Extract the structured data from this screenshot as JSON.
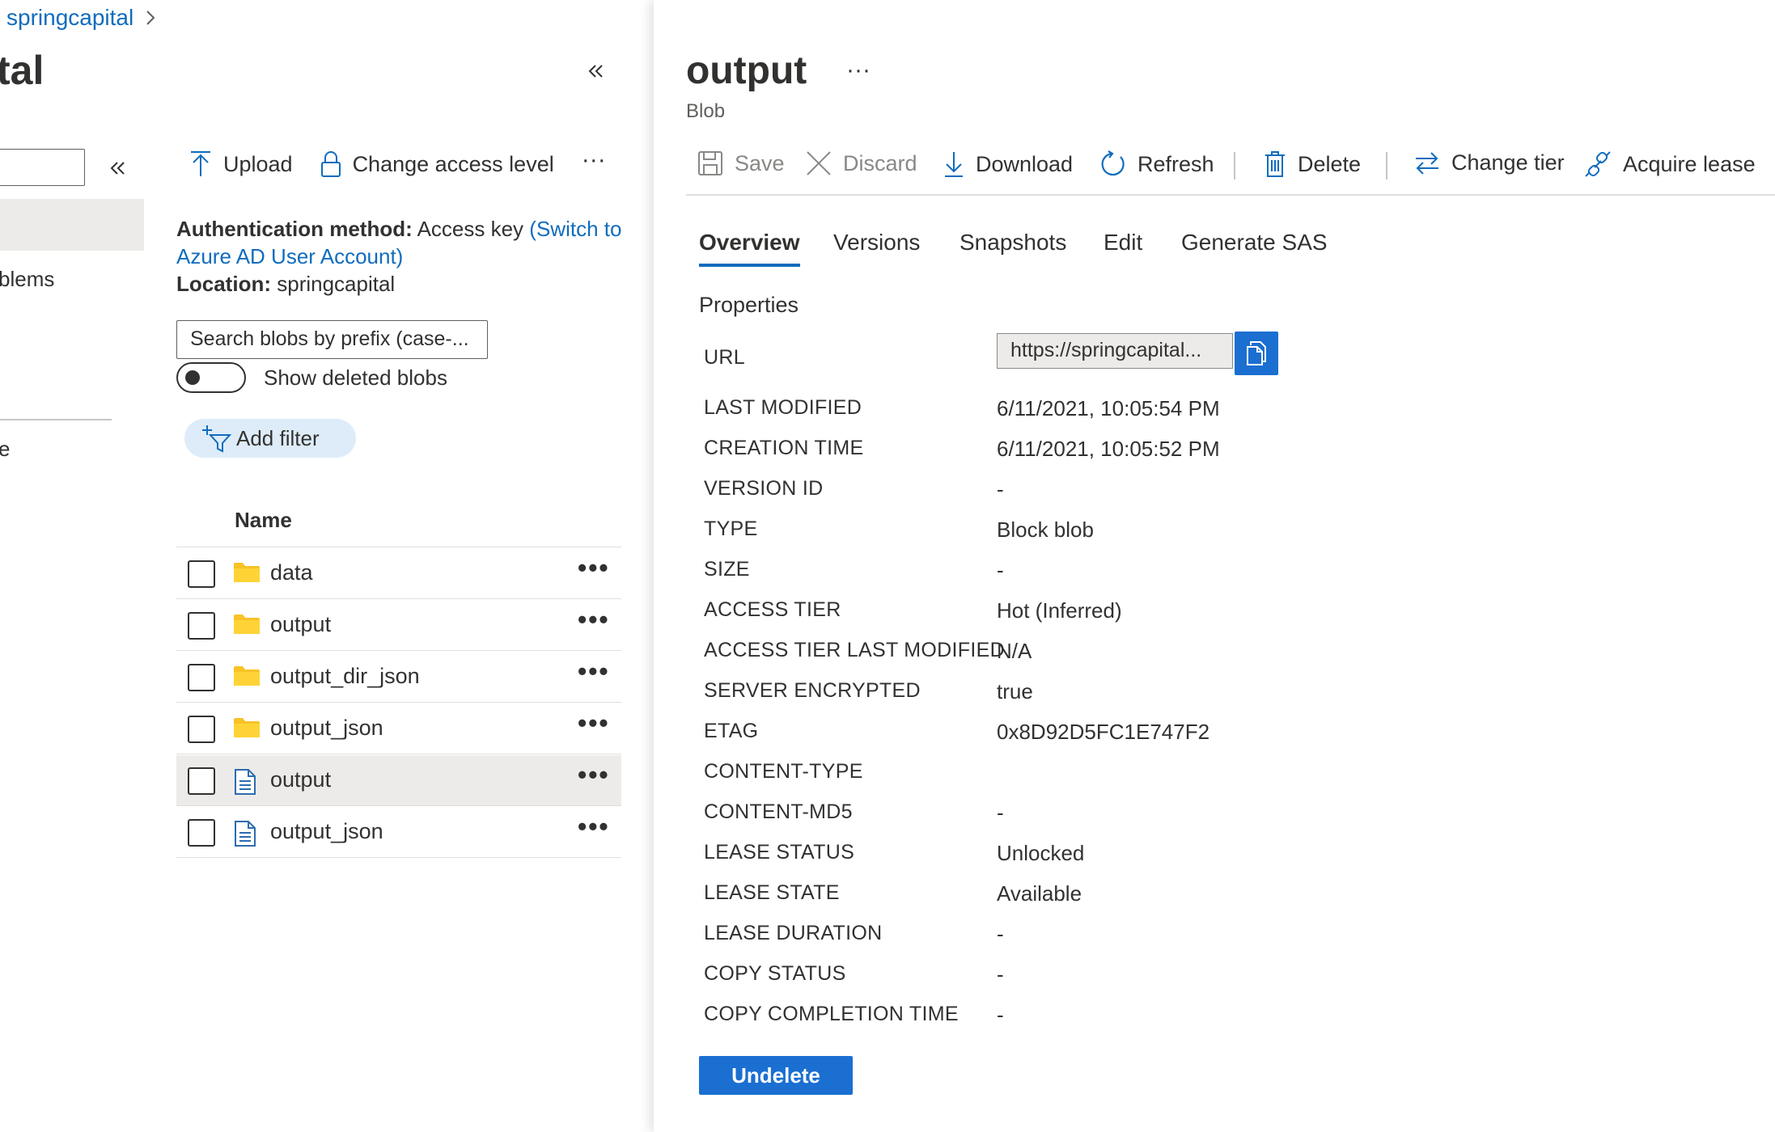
{
  "breadcrumb": {
    "item": "springcapital"
  },
  "blade": {
    "title_partial": "tal"
  },
  "nav": {
    "partial_item_1": "blems",
    "partial_item_2": "e"
  },
  "container": {
    "toolbar": {
      "upload_label": "Upload",
      "change_access_label": "Change access level",
      "more_label": "···"
    },
    "auth": {
      "method_label": "Authentication method:",
      "method_value": "Access key",
      "switch_link_1": "(Switch to",
      "switch_link_2": "Azure AD User Account)",
      "location_label": "Location:",
      "location_value": "springcapital"
    },
    "search_placeholder": "Search blobs by prefix (case-...",
    "show_deleted_label": "Show deleted blobs",
    "add_filter_label": "Add filter",
    "table": {
      "name_header": "Name",
      "rows": [
        {
          "name": "data",
          "type": "folder"
        },
        {
          "name": "output",
          "type": "folder"
        },
        {
          "name": "output_dir_json",
          "type": "folder"
        },
        {
          "name": "output_json",
          "type": "folder"
        },
        {
          "name": "output",
          "type": "file"
        },
        {
          "name": "output_json",
          "type": "file"
        }
      ],
      "more_label": "•••"
    }
  },
  "blob": {
    "title": "output",
    "subtitle": "Blob",
    "more_label": "···",
    "toolbar": {
      "save": "Save",
      "discard": "Discard",
      "download": "Download",
      "refresh": "Refresh",
      "delete": "Delete",
      "change_tier": "Change tier",
      "acquire_lease": "Acquire lease"
    },
    "tabs": [
      "Overview",
      "Versions",
      "Snapshots",
      "Edit",
      "Generate SAS"
    ],
    "active_tab": "Overview",
    "properties_heading": "Properties",
    "url_label": "URL",
    "url_value": "https://springcapital...",
    "properties": [
      {
        "label": "LAST MODIFIED",
        "value": "6/11/2021, 10:05:54 PM"
      },
      {
        "label": "CREATION TIME",
        "value": "6/11/2021, 10:05:52 PM"
      },
      {
        "label": "VERSION ID",
        "value": "-"
      },
      {
        "label": "TYPE",
        "value": "Block blob"
      },
      {
        "label": "SIZE",
        "value": "-"
      },
      {
        "label": "ACCESS TIER",
        "value": "Hot (Inferred)"
      },
      {
        "label": "ACCESS TIER LAST MODIFIED",
        "value": "N/A"
      },
      {
        "label": "SERVER ENCRYPTED",
        "value": "true"
      },
      {
        "label": "ETAG",
        "value": "0x8D92D5FC1E747F2"
      },
      {
        "label": "CONTENT-TYPE",
        "value": ""
      },
      {
        "label": "CONTENT-MD5",
        "value": "-"
      },
      {
        "label": "LEASE STATUS",
        "value": "Unlocked"
      },
      {
        "label": "LEASE STATE",
        "value": "Available"
      },
      {
        "label": "LEASE DURATION",
        "value": "-"
      },
      {
        "label": "COPY STATUS",
        "value": "-"
      },
      {
        "label": "COPY COMPLETION TIME",
        "value": "-"
      }
    ],
    "undelete_label": "Undelete"
  },
  "colors": {
    "accent": "#0f6cbd",
    "primary_button": "#1a6fd1",
    "folder": "#f7c325",
    "selected_row": "#edebe9"
  }
}
